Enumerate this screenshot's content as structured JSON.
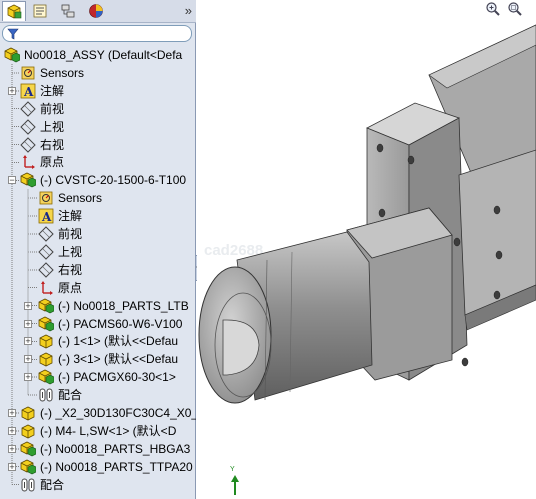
{
  "left_panel": {
    "tabs": [
      {
        "name": "featuremanager-tab",
        "icon": "assembly-tree-icon"
      },
      {
        "name": "propertymanager-tab",
        "icon": "property-icon"
      },
      {
        "name": "configurationmanager-tab",
        "icon": "configuration-icon"
      },
      {
        "name": "display-manager-tab",
        "icon": "appearance-icon"
      }
    ],
    "more_glyph": "»",
    "filter_icon": "filter-icon"
  },
  "tree": {
    "items": [
      {
        "label": "No0018_ASSY  (Default<Defa",
        "icon": "assembly",
        "level": 0,
        "expander": ""
      },
      {
        "label": "Sensors",
        "icon": "sensor",
        "level": 1,
        "expander": ""
      },
      {
        "label": "注解",
        "icon": "annotation",
        "level": 1,
        "expander": "+"
      },
      {
        "label": "前视",
        "icon": "plane",
        "level": 1,
        "expander": ""
      },
      {
        "label": "上视",
        "icon": "plane",
        "level": 1,
        "expander": ""
      },
      {
        "label": "右视",
        "icon": "plane",
        "level": 1,
        "expander": ""
      },
      {
        "label": "原点",
        "icon": "origin",
        "level": 1,
        "expander": ""
      },
      {
        "label": "(-) CVSTC-20-1500-6-T100",
        "icon": "assembly",
        "level": 1,
        "expander": "-"
      },
      {
        "label": "Sensors",
        "icon": "sensor",
        "level": 2,
        "expander": ""
      },
      {
        "label": "注解",
        "icon": "annotation",
        "level": 2,
        "expander": ""
      },
      {
        "label": "前视",
        "icon": "plane",
        "level": 2,
        "expander": ""
      },
      {
        "label": "上视",
        "icon": "plane",
        "level": 2,
        "expander": ""
      },
      {
        "label": "右视",
        "icon": "plane",
        "level": 2,
        "expander": ""
      },
      {
        "label": "原点",
        "icon": "origin",
        "level": 2,
        "expander": ""
      },
      {
        "label": "(-) No0018_PARTS_LTB",
        "icon": "assembly",
        "level": 2,
        "expander": "+"
      },
      {
        "label": "(-) PACMS60-W6-V100",
        "icon": "assembly",
        "level": 2,
        "expander": "+"
      },
      {
        "label": "(-) 1<1> (默认<<Defau",
        "icon": "part",
        "level": 2,
        "expander": "+"
      },
      {
        "label": "(-) 3<1> (默认<<Defau",
        "icon": "part",
        "level": 2,
        "expander": "+"
      },
      {
        "label": "(-) PACMGX60-30<1>",
        "icon": "assembly",
        "level": 2,
        "expander": "+"
      },
      {
        "label": "配合",
        "icon": "mate",
        "level": 2,
        "expander": ""
      },
      {
        "label": "(-) _X2_30D130FC30C4_X0_",
        "icon": "part",
        "level": 1,
        "expander": "+"
      },
      {
        "label": "(-) M4-   L,SW<1> (默认<D",
        "icon": "part",
        "level": 1,
        "expander": "+"
      },
      {
        "label": "(-) No0018_PARTS_HBGA3",
        "icon": "assembly",
        "level": 1,
        "expander": "+"
      },
      {
        "label": "(-) No0018_PARTS_TTPA20",
        "icon": "assembly",
        "level": 1,
        "expander": "+"
      },
      {
        "label": "配合",
        "icon": "mate",
        "level": 1,
        "expander": ""
      }
    ]
  },
  "viewport": {
    "toolbar": [
      {
        "name": "zoom-to-fit-icon"
      },
      {
        "name": "zoom-to-area-icon"
      }
    ],
    "watermark": "cad2688",
    "triad_label": "Y"
  }
}
